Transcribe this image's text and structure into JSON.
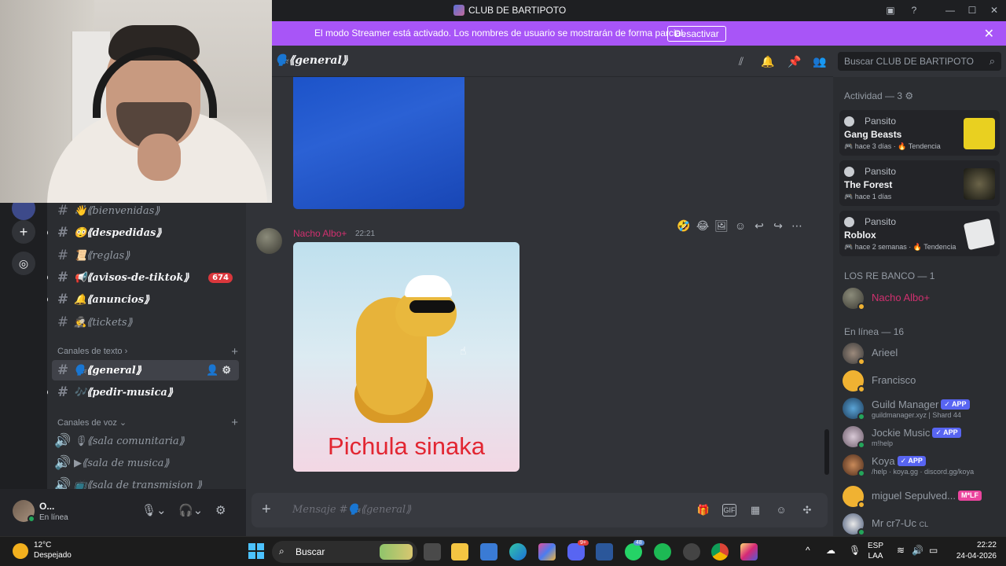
{
  "window": {
    "title": "CLUB DE BARTIPOTO",
    "buttons": [
      "inbox-icon",
      "help-icon",
      "minimize-icon",
      "maximize-icon",
      "close-icon"
    ]
  },
  "banner": {
    "text": "El modo Streamer está activado. Los nombres de usuario se mostrarán de forma parcial.",
    "button": "Desactivar",
    "color": "#a855f7"
  },
  "channel_header": {
    "name": "🗣️⟪general⟫"
  },
  "search": {
    "placeholder": "Buscar CLUB DE BARTIPOTO"
  },
  "sidebar": {
    "channels": [
      {
        "label": "👋⟪bienvenidas⟫"
      },
      {
        "label": "😳⟪despedidas⟫"
      },
      {
        "label": "📜⟪reglas⟫"
      },
      {
        "label": "📢⟪avisos-de-tiktok⟫",
        "badge": "674"
      },
      {
        "label": "🔔⟪anuncios⟫"
      },
      {
        "label": "🕵️⟪tickets⟫"
      }
    ],
    "text_category": "Canales de texto",
    "text_channels": [
      {
        "label": "🗣️⟪general⟫"
      },
      {
        "label": "🎶⟪pedir-musica⟫"
      }
    ],
    "voice_category": "Canales de voz",
    "voice_channels": [
      {
        "label": "🎙⟪sala comunitaria⟫"
      },
      {
        "label": "▶⟪sala de musica⟫"
      },
      {
        "label": "📺⟪sala de transmision ⟫"
      }
    ]
  },
  "user_panel": {
    "name": "O...",
    "status": "En línea"
  },
  "message": {
    "author": "Nacho Albo+",
    "time": "22:21",
    "image_caption": "Pichula sinaka",
    "author_color": "#d1306f"
  },
  "composer": {
    "placeholder": "Mensaje #🗣️⟪general⟫"
  },
  "members": {
    "activity_header": "Actividad — 3",
    "activities": [
      {
        "user": "Pansito",
        "game": "Gang Beasts",
        "meta": "🎮 hace 3 días · 🔥 Tendencia"
      },
      {
        "user": "Pansito",
        "game": "The Forest",
        "meta": "🎮 hace 1 días"
      },
      {
        "user": "Pansito",
        "game": "Roblox",
        "meta": "🎮 hace 2 semanas · 🔥 Tendencia"
      }
    ],
    "group_header": "LOS RE BANCO — 1",
    "group_member": "Nacho Albo+",
    "online_header": "En línea — 16",
    "online": [
      {
        "name": "Arieel",
        "sub": "",
        "tag": ""
      },
      {
        "name": "Francisco",
        "sub": "",
        "tag": ""
      },
      {
        "name": "Guild Manager",
        "sub": "guildmanager.xyz | Shard 44",
        "tag": "✓ APP"
      },
      {
        "name": "Jockie Music",
        "sub": "m!help",
        "tag": "✓ APP"
      },
      {
        "name": "Koya",
        "sub": "/help · koya.gg · discord.gg/koya",
        "tag": "✓ APP"
      },
      {
        "name": "miguel Sepulved...",
        "sub": "",
        "tag": "M*LF"
      },
      {
        "name": "Mr cr7-Uc",
        "sub": "",
        "tag": "CL"
      }
    ]
  },
  "taskbar": {
    "weather_temp": "12°C",
    "weather_desc": "Despejado",
    "search": "Buscar",
    "discord_badge": "9+",
    "whatsapp_badge": "48",
    "lang": "ESP",
    "layout": "LAA",
    "time": "22:22",
    "date": "24-04-2026"
  }
}
